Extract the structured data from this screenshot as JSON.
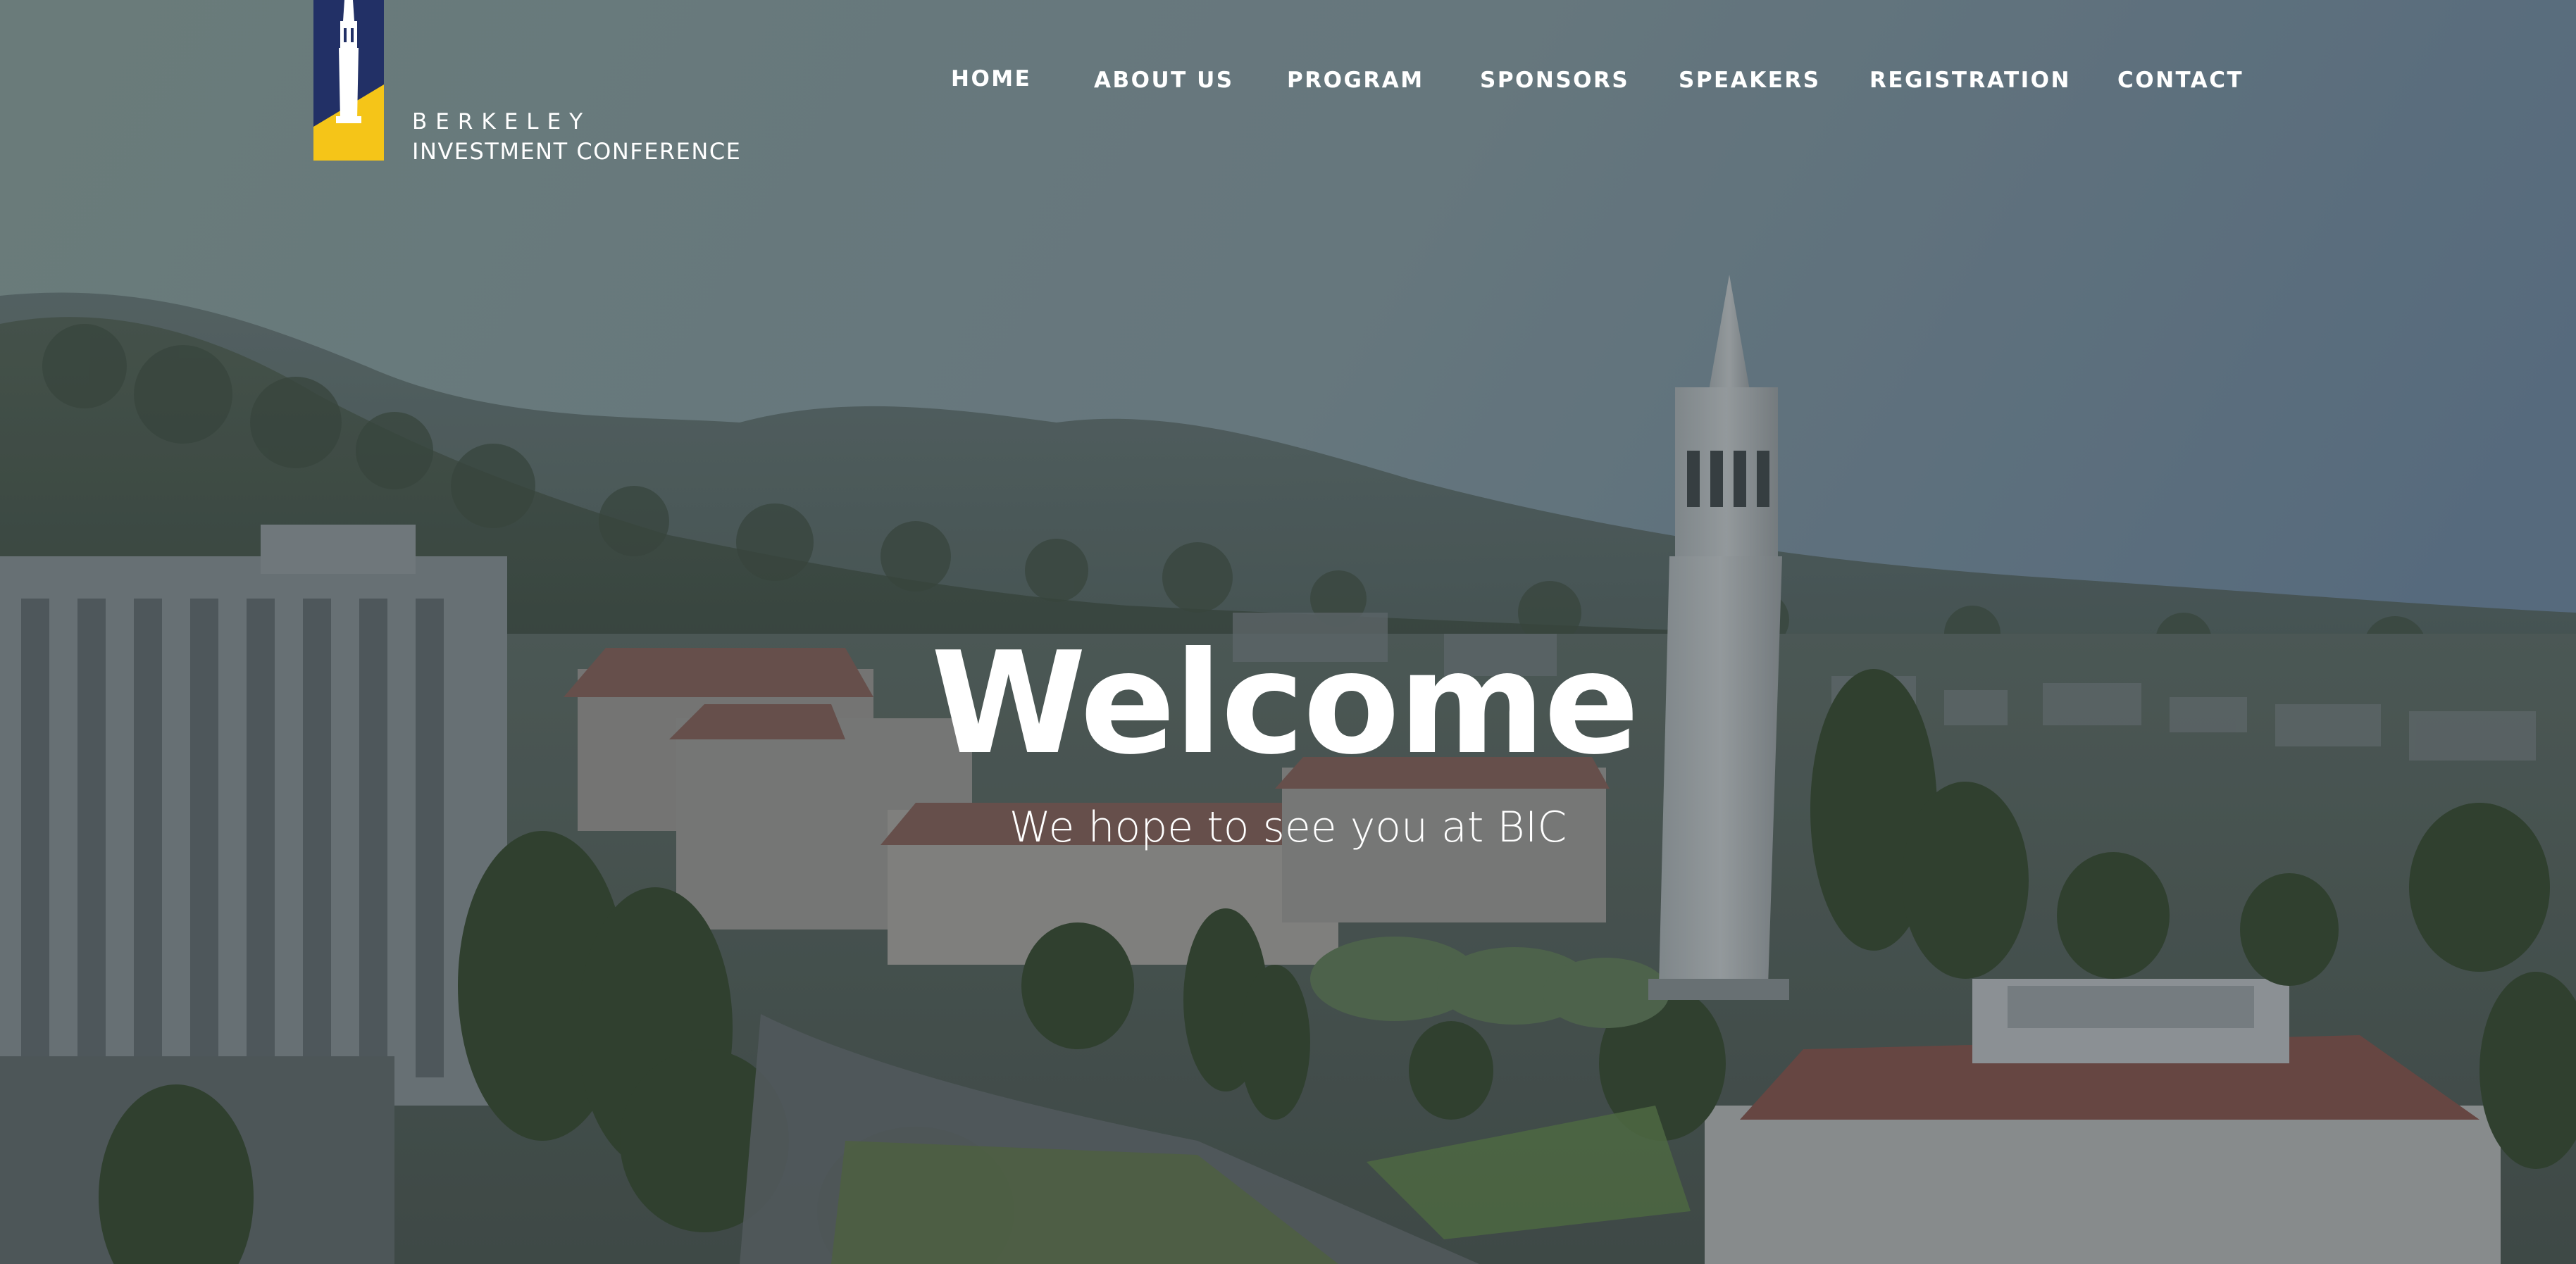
{
  "brand": {
    "logo_line1": "BERKELEY",
    "logo_line2": "INVESTMENT CONFERENCE",
    "colors": {
      "navy": "#223066",
      "gold": "#f5c518"
    }
  },
  "nav": {
    "items": [
      {
        "label": "HOME",
        "active": true
      },
      {
        "label": "ABOUT US"
      },
      {
        "label": "PROGRAM"
      },
      {
        "label": "SPONSORS"
      },
      {
        "label": "SPEAKERS"
      },
      {
        "label": "REGISTRATION"
      },
      {
        "label": "CONTACT"
      }
    ]
  },
  "hero": {
    "title": "Welcome",
    "subtitle": "We hope to see you at BIC"
  }
}
